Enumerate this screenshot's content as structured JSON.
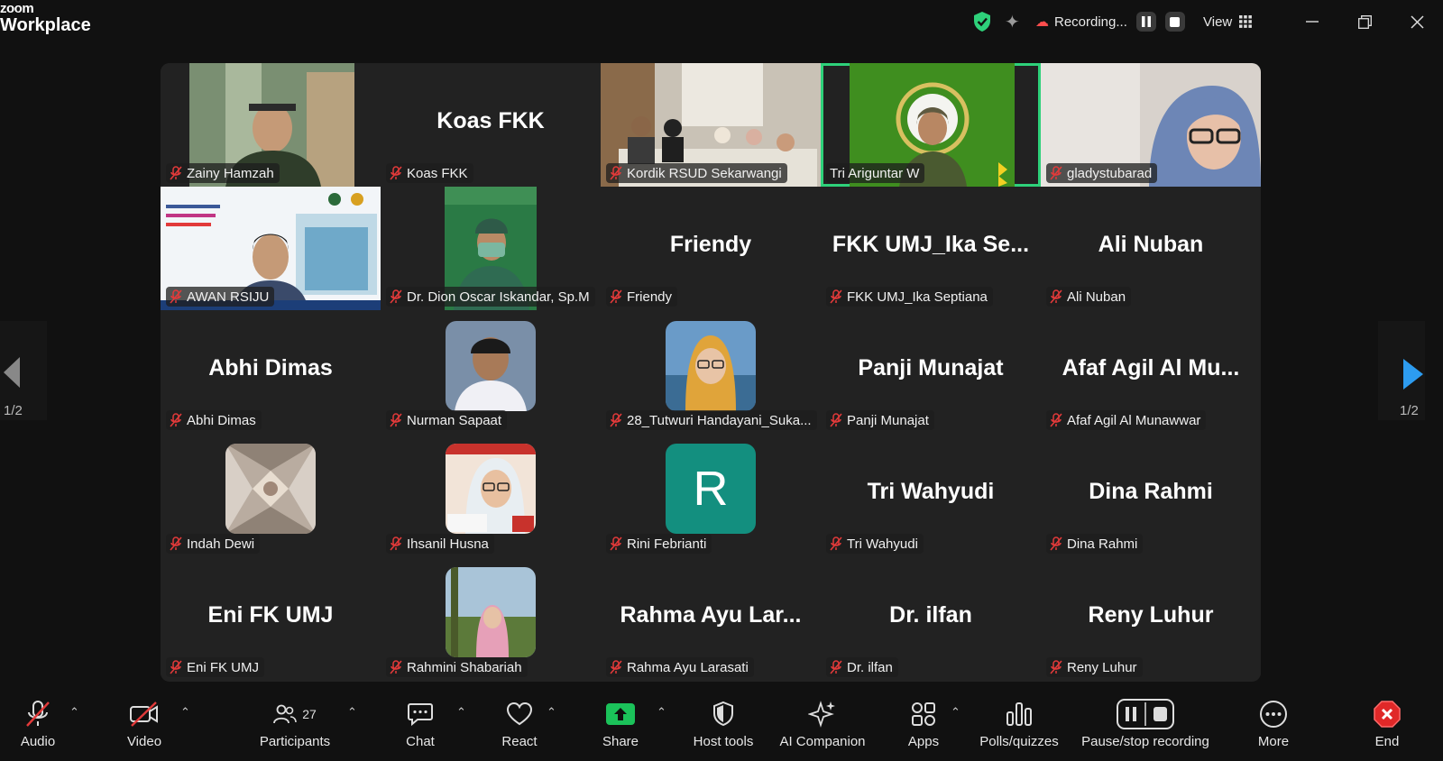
{
  "titlebar": {
    "brand_line1": "zoom",
    "brand_line2": "Workplace",
    "recording_label": "Recording...",
    "view_label": "View"
  },
  "pagination": {
    "left": "1/2",
    "right": "1/2"
  },
  "participants": [
    {
      "name": "Zainy Hamzah",
      "display": "",
      "type": "video",
      "muted": true
    },
    {
      "name": "Koas FKK",
      "display": "Koas FKK",
      "type": "name",
      "muted": true
    },
    {
      "name": "Kordik RSUD Sekarwangi",
      "display": "",
      "type": "video",
      "muted": true
    },
    {
      "name": "Tri Ariguntar W",
      "display": "",
      "type": "video",
      "muted": false,
      "active": true
    },
    {
      "name": "gladystubarad",
      "display": "",
      "type": "video",
      "muted": true
    },
    {
      "name": "AWAN RSIJU",
      "display": "",
      "type": "video",
      "muted": true
    },
    {
      "name": "Dr. Dion Oscar Iskandar, Sp.M",
      "display": "",
      "type": "video",
      "muted": true
    },
    {
      "name": "Friendy",
      "display": "Friendy",
      "type": "name",
      "muted": true
    },
    {
      "name": "FKK UMJ_Ika Septiana",
      "display": "FKK UMJ_Ika Se...",
      "type": "name",
      "muted": true
    },
    {
      "name": "Ali Nuban",
      "display": "Ali Nuban",
      "type": "name",
      "muted": true
    },
    {
      "name": "Abhi Dimas",
      "display": "Abhi Dimas",
      "type": "name",
      "muted": true
    },
    {
      "name": "Nurman Sapaat",
      "display": "",
      "type": "photo",
      "muted": true
    },
    {
      "name": "28_Tutwuri Handayani_Suka...",
      "display": "",
      "type": "photo",
      "muted": true
    },
    {
      "name": "Panji Munajat",
      "display": "Panji Munajat",
      "type": "name",
      "muted": true
    },
    {
      "name": "Afaf Agil Al Munawwar",
      "display": "Afaf Agil Al Mu...",
      "type": "name",
      "muted": true
    },
    {
      "name": "Indah Dewi",
      "display": "",
      "type": "photo",
      "muted": true
    },
    {
      "name": "Ihsanil Husna",
      "display": "",
      "type": "photo",
      "muted": true
    },
    {
      "name": "Rini Febrianti",
      "display": "R",
      "type": "avatar",
      "muted": true
    },
    {
      "name": "Tri Wahyudi",
      "display": "Tri Wahyudi",
      "type": "name",
      "muted": true
    },
    {
      "name": "Dina Rahmi",
      "display": "Dina Rahmi",
      "type": "name",
      "muted": true
    },
    {
      "name": "Eni FK UMJ",
      "display": "Eni FK UMJ",
      "type": "name",
      "muted": true
    },
    {
      "name": "Rahmini Shabariah",
      "display": "",
      "type": "photo",
      "muted": true
    },
    {
      "name": "Rahma Ayu Larasati",
      "display": "Rahma  Ayu  Lar...",
      "type": "name",
      "muted": true
    },
    {
      "name": "Dr. ilfan",
      "display": "Dr. ilfan",
      "type": "name",
      "muted": true
    },
    {
      "name": "Reny Luhur",
      "display": "Reny Luhur",
      "type": "name",
      "muted": true
    }
  ],
  "toolbar": {
    "audio": "Audio",
    "video": "Video",
    "participants": "Participants",
    "participants_count": "27",
    "chat": "Chat",
    "react": "React",
    "share": "Share",
    "host_tools": "Host tools",
    "ai_companion": "AI Companion",
    "apps": "Apps",
    "polls": "Polls/quizzes",
    "pause_recording": "Pause/stop recording",
    "more": "More",
    "end": "End"
  },
  "colors": {
    "active_speaker": "#2ed17a",
    "share_green": "#1bc25a",
    "end_red": "#e02828",
    "mute_red": "#e23a3a"
  }
}
